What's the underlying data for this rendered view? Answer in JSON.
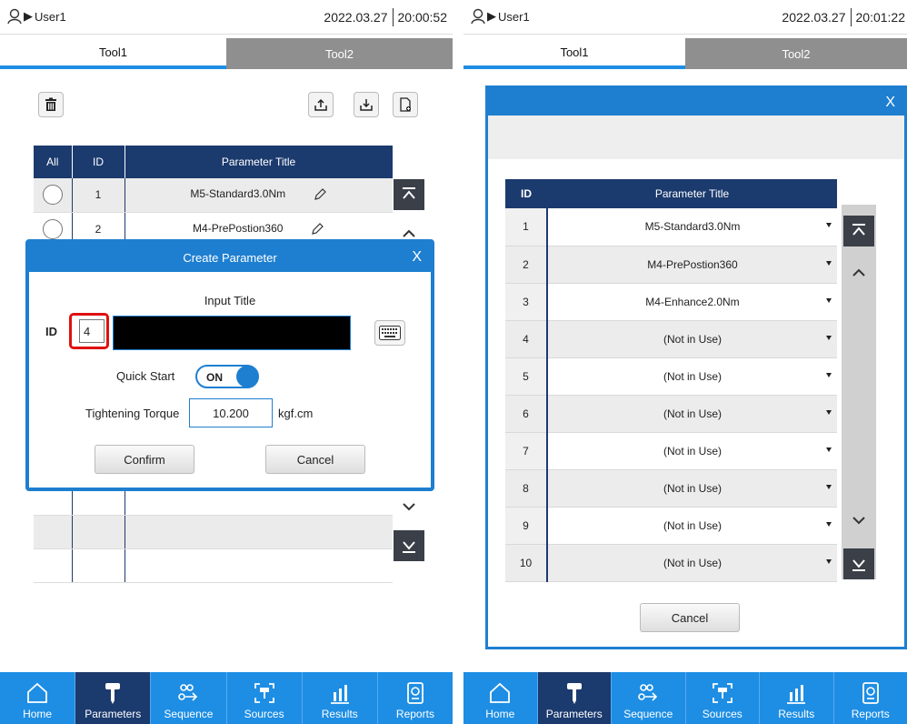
{
  "left": {
    "status": {
      "user": "User1",
      "date": "2022.03.27",
      "time": "20:00:52"
    },
    "tabs": [
      "Tool1",
      "Tool2"
    ],
    "table": {
      "headers": [
        "All",
        "ID",
        "Parameter Title"
      ],
      "rows": [
        {
          "id": "1",
          "title": "M5-Standard3.0Nm"
        },
        {
          "id": "2",
          "title": "M4-PrePostion360"
        }
      ]
    },
    "dialog": {
      "title": "Create Parameter",
      "close": "X",
      "input_title_label": "Input Title",
      "id_label": "ID",
      "id_value": "4",
      "quick_start_label": "Quick Start",
      "quick_start_state": "ON",
      "torque_label": "Tightening Torque",
      "torque_value": "10.200",
      "torque_unit": "kgf.cm",
      "confirm": "Confirm",
      "cancel": "Cancel"
    }
  },
  "right": {
    "status": {
      "user": "User1",
      "date": "2022.03.27",
      "time": "20:01:22"
    },
    "tabs": [
      "Tool1",
      "Tool2"
    ],
    "dialog": {
      "close": "X",
      "headers": [
        "ID",
        "Parameter Title"
      ],
      "rows": [
        {
          "id": "1",
          "title": "M5-Standard3.0Nm"
        },
        {
          "id": "2",
          "title": "M4-PrePostion360"
        },
        {
          "id": "3",
          "title": "M4-Enhance2.0Nm"
        },
        {
          "id": "4",
          "title": "(Not in Use)"
        },
        {
          "id": "5",
          "title": "(Not in Use)"
        },
        {
          "id": "6",
          "title": "(Not in Use)"
        },
        {
          "id": "7",
          "title": "(Not in Use)"
        },
        {
          "id": "8",
          "title": "(Not in Use)"
        },
        {
          "id": "9",
          "title": "(Not in Use)"
        },
        {
          "id": "10",
          "title": "(Not in Use)"
        }
      ],
      "cancel": "Cancel"
    }
  },
  "nav": [
    "Home",
    "Parameters",
    "Sequence",
    "Sources",
    "Results",
    "Reports"
  ],
  "active_nav": "Parameters",
  "colors": {
    "accent": "#1e8ee4",
    "dark_navy": "#1b3a6e",
    "highlight": "#e01010"
  }
}
